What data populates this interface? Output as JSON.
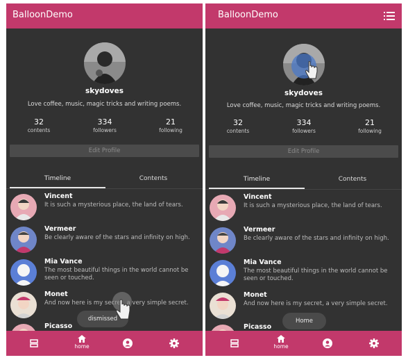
{
  "colors": {
    "accent": "#c2396b",
    "background": "#323232",
    "tab_indicator": "#e6e6e6"
  },
  "screens": [
    {
      "app_title": "BalloonDemo",
      "profile": {
        "name": "skydoves",
        "bio": "Love coffee, music, magic tricks and writing poems.",
        "stats": [
          {
            "value": "32",
            "label": "contents"
          },
          {
            "value": "334",
            "label": "followers"
          },
          {
            "value": "21",
            "label": "following"
          }
        ],
        "edit_label": "Edit Profile"
      },
      "tabs": [
        "Timeline",
        "Contents"
      ],
      "items": [
        {
          "name": "Vincent",
          "message": "It is such a mysterious place, the land of tears."
        },
        {
          "name": "Vermeer",
          "message": "Be clearly aware of the stars and infinity on high."
        },
        {
          "name": "Mia Vance",
          "message": "The most beautiful things in the world cannot be seen or touched."
        },
        {
          "name": "Monet",
          "message": "And now here is my secret, a very simple secret."
        },
        {
          "name": "Picasso",
          "message": ""
        }
      ],
      "balloon_text": "dismissed",
      "nav": {
        "home_label": "home"
      }
    },
    {
      "app_title": "BalloonDemo",
      "profile": {
        "name": "skydoves",
        "bio": "Love coffee, music, magic tricks and writing poems.",
        "stats": [
          {
            "value": "32",
            "label": "contents"
          },
          {
            "value": "334",
            "label": "followers"
          },
          {
            "value": "21",
            "label": "following"
          }
        ],
        "edit_label": "Edit Profile"
      },
      "tabs": [
        "Timeline",
        "Contents"
      ],
      "items": [
        {
          "name": "Vincent",
          "message": "It is such a mysterious place, the land of tears."
        },
        {
          "name": "Vermeer",
          "message": "Be clearly aware of the stars and infinity on high."
        },
        {
          "name": "Mia Vance",
          "message": "The most beautiful things in the world cannot be seen or touched."
        },
        {
          "name": "Monet",
          "message": "And now here is my secret, a very simple secret."
        },
        {
          "name": "Picasso",
          "message": ""
        }
      ],
      "balloon_text": "Home",
      "nav": {
        "home_label": "home"
      }
    }
  ],
  "icons": [
    "menu-icon",
    "list-icon",
    "home-icon",
    "profile-icon",
    "settings-icon",
    "hand-cursor-icon"
  ]
}
